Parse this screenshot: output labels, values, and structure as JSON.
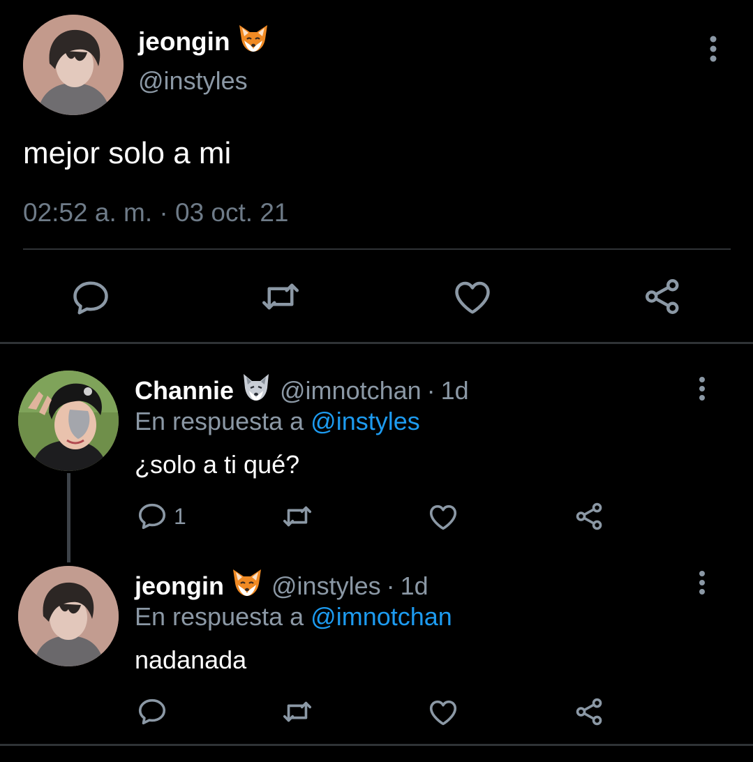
{
  "main_tweet": {
    "display_name": "jeongin",
    "name_emoji": "fox-face",
    "handle": "@instyles",
    "text": "mejor solo a mi",
    "timestamp": "02:52 a. m. · 03 oct. 21",
    "actions": {
      "reply_icon": "speech-bubble-icon",
      "retweet_icon": "retweet-icon",
      "like_icon": "heart-icon",
      "share_icon": "share-icon"
    }
  },
  "replies": [
    {
      "display_name": "Channie",
      "name_emoji": "wolf-face",
      "handle": "@imnotchan",
      "separator": "·",
      "time": "1d",
      "in_reply_prefix": "En respuesta a",
      "in_reply_to": "@instyles",
      "text": "¿solo a ti qué?",
      "reply_count": "1"
    },
    {
      "display_name": "jeongin",
      "name_emoji": "fox-face",
      "handle": "@instyles",
      "separator": "·",
      "time": "1d",
      "in_reply_prefix": "En respuesta a",
      "in_reply_to": "@imnotchan",
      "text": "nadanada",
      "reply_count": ""
    }
  ],
  "colors": {
    "background": "#000000",
    "text_primary": "#ffffff",
    "text_secondary": "#8b98a5",
    "mention": "#1d9bf0",
    "divider": "#2f3336"
  }
}
